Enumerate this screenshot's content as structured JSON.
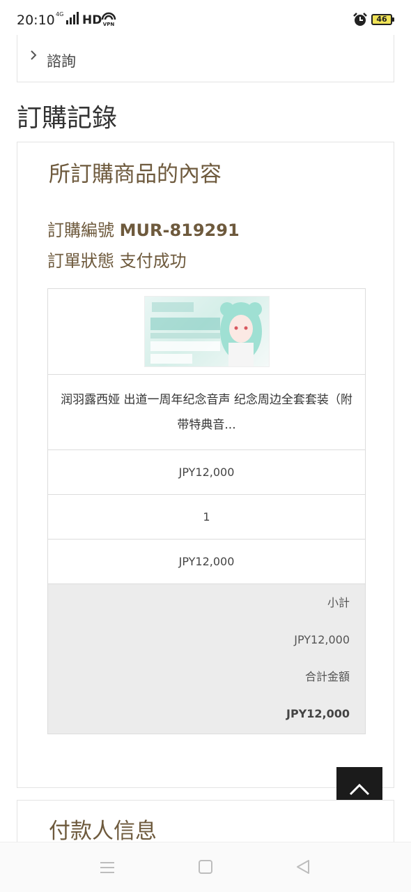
{
  "status_bar": {
    "time": "20:10",
    "network": "4G",
    "hd": "HD",
    "vpn_icon": "vpn-icon",
    "alarm_icon": "alarm-icon",
    "battery": "46"
  },
  "inquiry": {
    "label": "諮詢"
  },
  "page": {
    "section_title": "訂購記錄"
  },
  "order": {
    "heading": "所訂購商品的內容",
    "number_label": "訂購編號",
    "number_value": "MUR-819291",
    "status_label": "訂單狀態",
    "status_value": "支付成功",
    "item": {
      "name": "润羽露西娅 出道一周年纪念音声 纪念周边全套套装（附带特典音...",
      "unit_price": "JPY12,000",
      "quantity": "1",
      "line_total": "JPY12,000"
    },
    "summary": {
      "subtotal_label": "小計",
      "subtotal_value": "JPY12,000",
      "total_label": "合計金額",
      "total_value": "JPY12,000"
    }
  },
  "payer": {
    "title": "付款人信息"
  },
  "colors": {
    "accent_brown": "#6e5a3d",
    "back_to_top": "#1b1b1b",
    "summary_bg": "#ececec"
  }
}
